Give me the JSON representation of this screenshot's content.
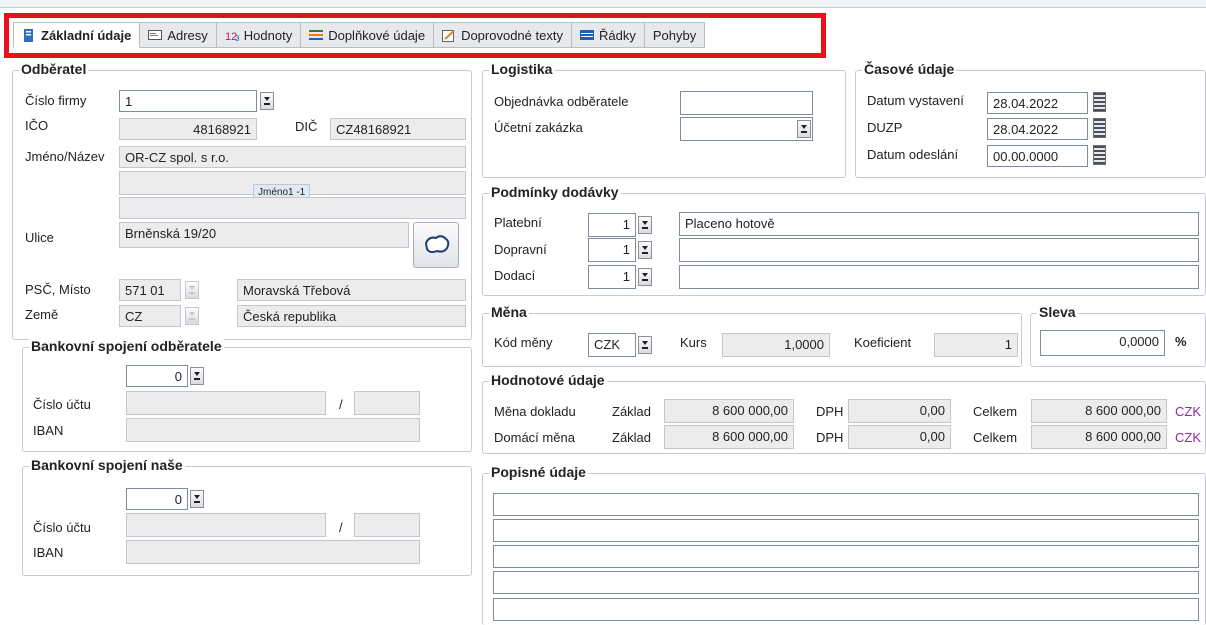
{
  "tabs": [
    {
      "label": "Základní údaje",
      "icon": "document-icon",
      "active": true
    },
    {
      "label": "Adresy",
      "icon": "address-card-icon"
    },
    {
      "label": "Hodnoty",
      "icon": "numbers-icon"
    },
    {
      "label": "Doplňkové údaje",
      "icon": "stack-icon"
    },
    {
      "label": "Doprovodné texty",
      "icon": "edit-note-icon"
    },
    {
      "label": "Řádky",
      "icon": "rows-icon"
    },
    {
      "label": "Pohyby",
      "icon": ""
    }
  ],
  "odberatel": {
    "legend": "Odběratel",
    "cislo_firmy_label": "Číslo firmy",
    "cislo_firmy": "1",
    "ico_label": "IČO",
    "ico": "48168921",
    "dic_label": "DIČ",
    "dic": "CZ48168921",
    "jmeno_label": "Jméno/Název",
    "jmeno": "OR-CZ spol. s r.o.",
    "jmeno_tag": "Jméno1 -1",
    "ulice_label": "Ulice",
    "ulice": "Brněnská 19/20",
    "psc_label": "PSČ, Místo",
    "psc": "571 01",
    "misto": "Moravská Třebová",
    "zeme_label": "Země",
    "zeme_kod": "CZ",
    "zeme": "Česká republika"
  },
  "banka_odberatel": {
    "legend": "Bankovní spojení odběratele",
    "spinner": "0",
    "cislo_uctu_label": "Číslo účtu",
    "slash": "/",
    "iban_label": "IBAN"
  },
  "banka_nase": {
    "legend": "Bankovní spojení naše",
    "spinner": "0",
    "cislo_uctu_label": "Číslo účtu",
    "slash": "/",
    "iban_label": "IBAN"
  },
  "logistika": {
    "legend": "Logistika",
    "objednavka_label": "Objednávka odběratele",
    "zakazka_label": "Účetní zakázka"
  },
  "casove": {
    "legend": "Časové údaje",
    "vystaveni_label": "Datum vystavení",
    "vystaveni": "28.04.2022",
    "duzp_label": "DUZP",
    "duzp": "28.04.2022",
    "odeslani_label": "Datum odeslání",
    "odeslani": "00.00.0000"
  },
  "podminky": {
    "legend": "Podmínky dodávky",
    "platebni_label": "Platební",
    "platebni": "1",
    "platebni_text": "Placeno hotově",
    "dopravni_label": "Dopravní",
    "dopravni": "1",
    "dodaci_label": "Dodací",
    "dodaci": "1"
  },
  "mena": {
    "legend": "Měna",
    "kod_label": "Kód měny",
    "kod": "CZK",
    "kurs_label": "Kurs",
    "kurs": "1,0000",
    "koef_label": "Koeficient",
    "koef": "1"
  },
  "sleva": {
    "legend": "Sleva",
    "value": "0,0000",
    "unit": "%"
  },
  "hodnotove": {
    "legend": "Hodnotové údaje",
    "rows": [
      {
        "label": "Měna dokladu",
        "zaklad_label": "Základ",
        "zaklad": "8 600 000,00",
        "dph_label": "DPH",
        "dph": "0,00",
        "celkem_label": "Celkem",
        "celkem": "8 600 000,00",
        "mena": "CZK"
      },
      {
        "label": "Domácí měna",
        "zaklad_label": "Základ",
        "zaklad": "8 600 000,00",
        "dph_label": "DPH",
        "dph": "0,00",
        "celkem_label": "Celkem",
        "celkem": "8 600 000,00",
        "mena": "CZK"
      }
    ]
  },
  "popisne": {
    "legend": "Popisné údaje"
  },
  "colors": {
    "highlight": "#e8111b",
    "currency": "#8b2f9e"
  }
}
